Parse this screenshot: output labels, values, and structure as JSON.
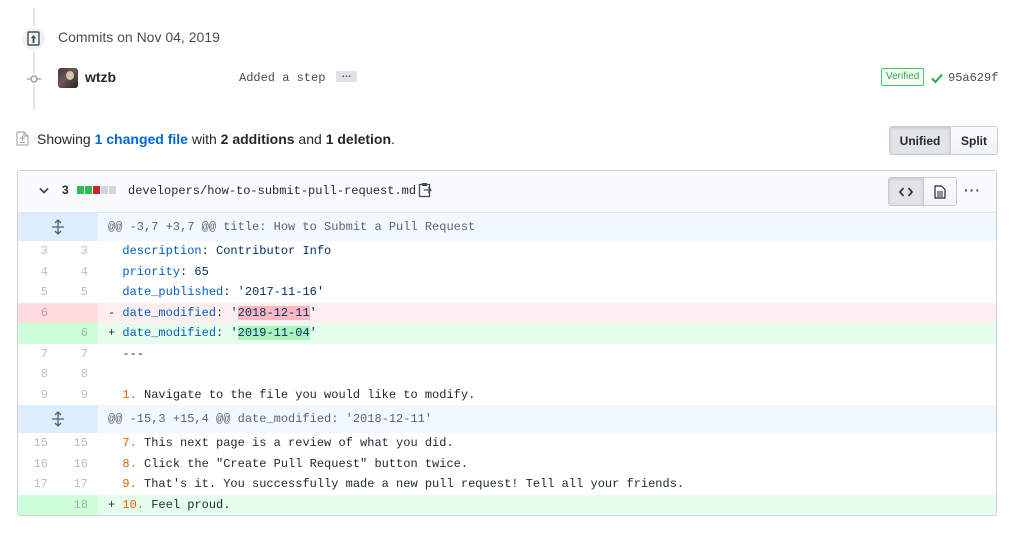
{
  "timeline": {
    "title": "Commits on Nov 04, 2019",
    "commit": {
      "author": "wtzb",
      "message": "Added a step",
      "ellipsis": "…",
      "verified_label": "Verified",
      "sha": "95a629f"
    }
  },
  "summary": {
    "prefix": "Showing ",
    "changed_files": "1 changed file",
    "with": " with ",
    "additions": "2 additions",
    "and": " and ",
    "deletions": "1 deletion",
    "suffix": "."
  },
  "view_toggle": {
    "unified": "Unified",
    "split": "Split",
    "selected": "Unified"
  },
  "file": {
    "change_count": "3",
    "diffstat": [
      "added",
      "added",
      "deleted",
      "neutral",
      "neutral"
    ],
    "path": "developers/how-to-submit-pull-request.md",
    "more": "···",
    "hunks": [
      {
        "header": "@@ -3,7 +3,7 @@ title: How to Submit a Pull Request",
        "lines": [
          {
            "old": "3",
            "new": "3",
            "type": "ctx",
            "sign": " ",
            "key": "description",
            "sep": ": ",
            "value": "Contributor Info"
          },
          {
            "old": "4",
            "new": "4",
            "type": "ctx",
            "sign": " ",
            "key": "priority",
            "sep": ": ",
            "value": "65"
          },
          {
            "old": "5",
            "new": "5",
            "type": "ctx",
            "sign": " ",
            "key": "date_published",
            "sep": ": ",
            "value": "'2017-11-16'"
          },
          {
            "old": "6",
            "new": "",
            "type": "del",
            "sign": "-",
            "key": "date_modified",
            "sep": ": ",
            "q1": "'",
            "value": "2018-12-11",
            "q2": "'"
          },
          {
            "old": "",
            "new": "6",
            "type": "add",
            "sign": "+",
            "key": "date_modified",
            "sep": ": ",
            "q1": "'",
            "value": "2019-11-04",
            "q2": "'"
          },
          {
            "old": "7",
            "new": "7",
            "type": "ctx",
            "sign": " ",
            "text": "---"
          },
          {
            "old": "8",
            "new": "8",
            "type": "ctx",
            "sign": " ",
            "text": ""
          },
          {
            "old": "9",
            "new": "9",
            "type": "ctx",
            "sign": " ",
            "num": "1.",
            "text": " Navigate to the file you would like to modify."
          }
        ]
      },
      {
        "header": "@@ -15,3 +15,4 @@ date_modified: '2018-12-11'",
        "lines": [
          {
            "old": "15",
            "new": "15",
            "type": "ctx",
            "sign": " ",
            "num": "7.",
            "text": " This next page is a review of what you did."
          },
          {
            "old": "16",
            "new": "16",
            "type": "ctx",
            "sign": " ",
            "num": "8.",
            "text": " Click the \"Create Pull Request\" button twice."
          },
          {
            "old": "17",
            "new": "17",
            "type": "ctx",
            "sign": " ",
            "num": "9.",
            "text": " That's it. You successfully made a new pull request! Tell all your friends."
          },
          {
            "old": "",
            "new": "18",
            "type": "add",
            "sign": "+",
            "num": "10.",
            "text": " Feel proud."
          }
        ]
      }
    ]
  },
  "colors": {
    "added": "#2cbe4e",
    "deleted": "#cb2431",
    "neutral": "#d1d5da",
    "link": "#0366d6"
  }
}
